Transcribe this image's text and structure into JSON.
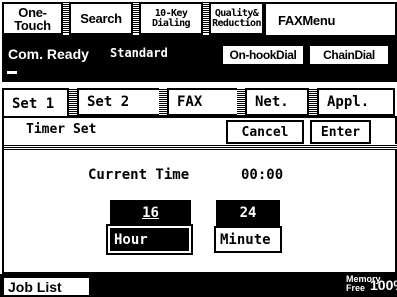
{
  "function_tabs": {
    "one_touch": "One-Touch",
    "search": "Search",
    "ten_key_line1": "10-Key",
    "ten_key_line2": "Dialing",
    "quality_line1": "Quality&",
    "quality_line2": "Reduction",
    "fax_menu": "FAXMenu"
  },
  "status": {
    "text": "Com. Ready",
    "mode": "Standard",
    "on_hook_dial": "On-hookDial",
    "chain_dial": "ChainDial"
  },
  "menu_tabs": [
    "Set 1",
    "Set 2",
    "FAX",
    "Net.",
    "Appl."
  ],
  "panel": {
    "title": "Timer Set",
    "cancel": "Cancel",
    "enter": "Enter",
    "current_time_label": "Current Time",
    "current_time_value": "00:00",
    "hour_value": "16",
    "hour_label": "Hour",
    "minute_value": "24",
    "minute_label": "Minute"
  },
  "bottom": {
    "job_list": "Job List",
    "memory_line1": "Memory",
    "memory_line2": "Free",
    "memory_percent": "100%"
  }
}
